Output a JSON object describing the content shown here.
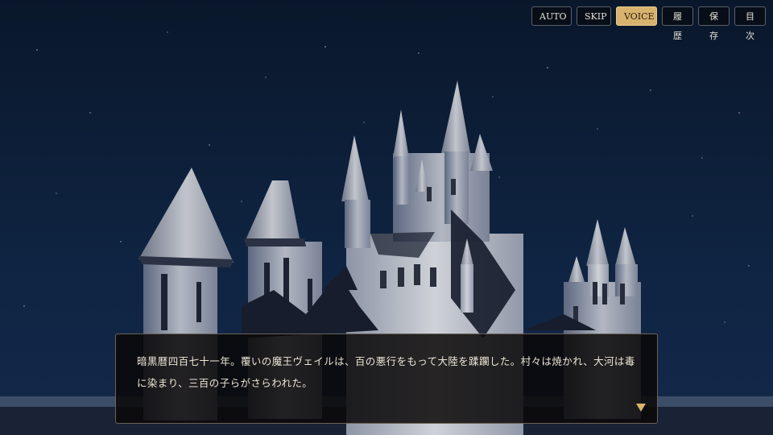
{
  "menu": {
    "auto_label": "AUTO",
    "skip_label": "SKIP",
    "voice_label": "VOICE",
    "history_label": "履歴",
    "save_label": "保存",
    "contents_label": "目次",
    "active_item": "VOICE"
  },
  "dialogue": {
    "text": "暗黒暦四百七十一年。覆いの魔王ヴェイルは、百の悪行をもって大陸を蹂躙した。村々は焼かれ、大河は毒に染まり、三百の子らがさらわれた。",
    "advance_icon": "triangle-down-icon"
  },
  "colors": {
    "sky": "#0c1a30",
    "accent": "#d9b36e",
    "dialogue_bg": "#0a0808",
    "text": "#ece6d6"
  }
}
